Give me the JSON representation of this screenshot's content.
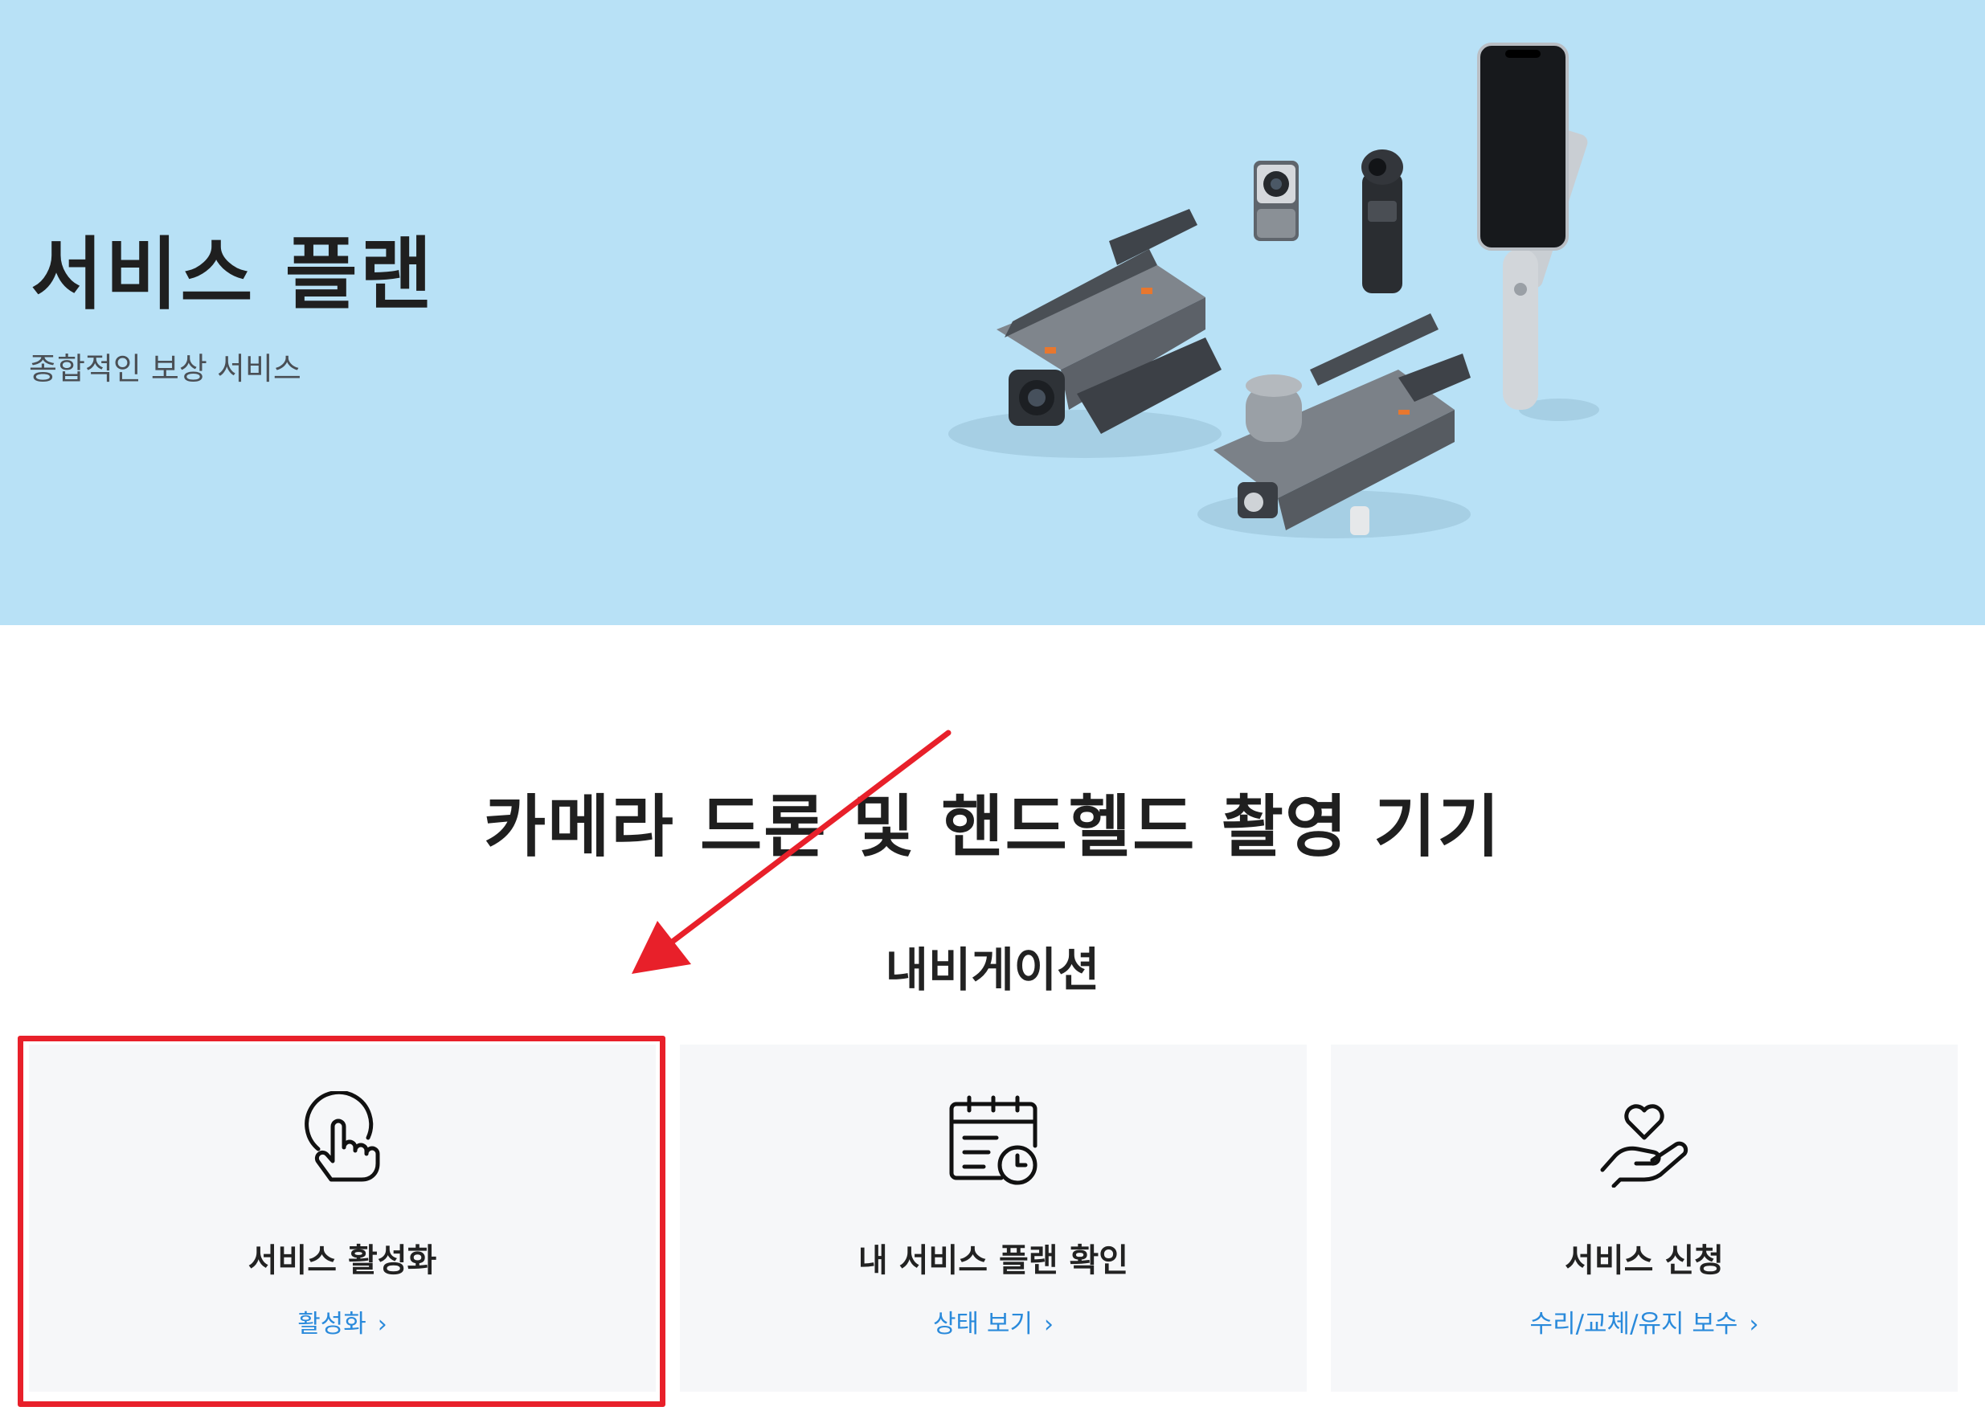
{
  "hero": {
    "title": "서비스 플랜",
    "subtitle": "종합적인 보상 서비스",
    "background_color": "#b8e1f6"
  },
  "section": {
    "title": "카메라 드론 및 핸드헬드 촬영 기기"
  },
  "navigation": {
    "title": "내비게이션",
    "cards": [
      {
        "icon": "tap-hand-icon",
        "title": "서비스 활성화",
        "link": "활성화"
      },
      {
        "icon": "calendar-clock-icon",
        "title": "내 서비스 플랜 확인",
        "link": "상태 보기"
      },
      {
        "icon": "heart-hand-icon",
        "title": "서비스 신청",
        "link": "수리/교체/유지 보수"
      }
    ]
  },
  "colors": {
    "link": "#2a8adb",
    "annotation": "#e8202a",
    "card_background": "#f6f7f9"
  }
}
